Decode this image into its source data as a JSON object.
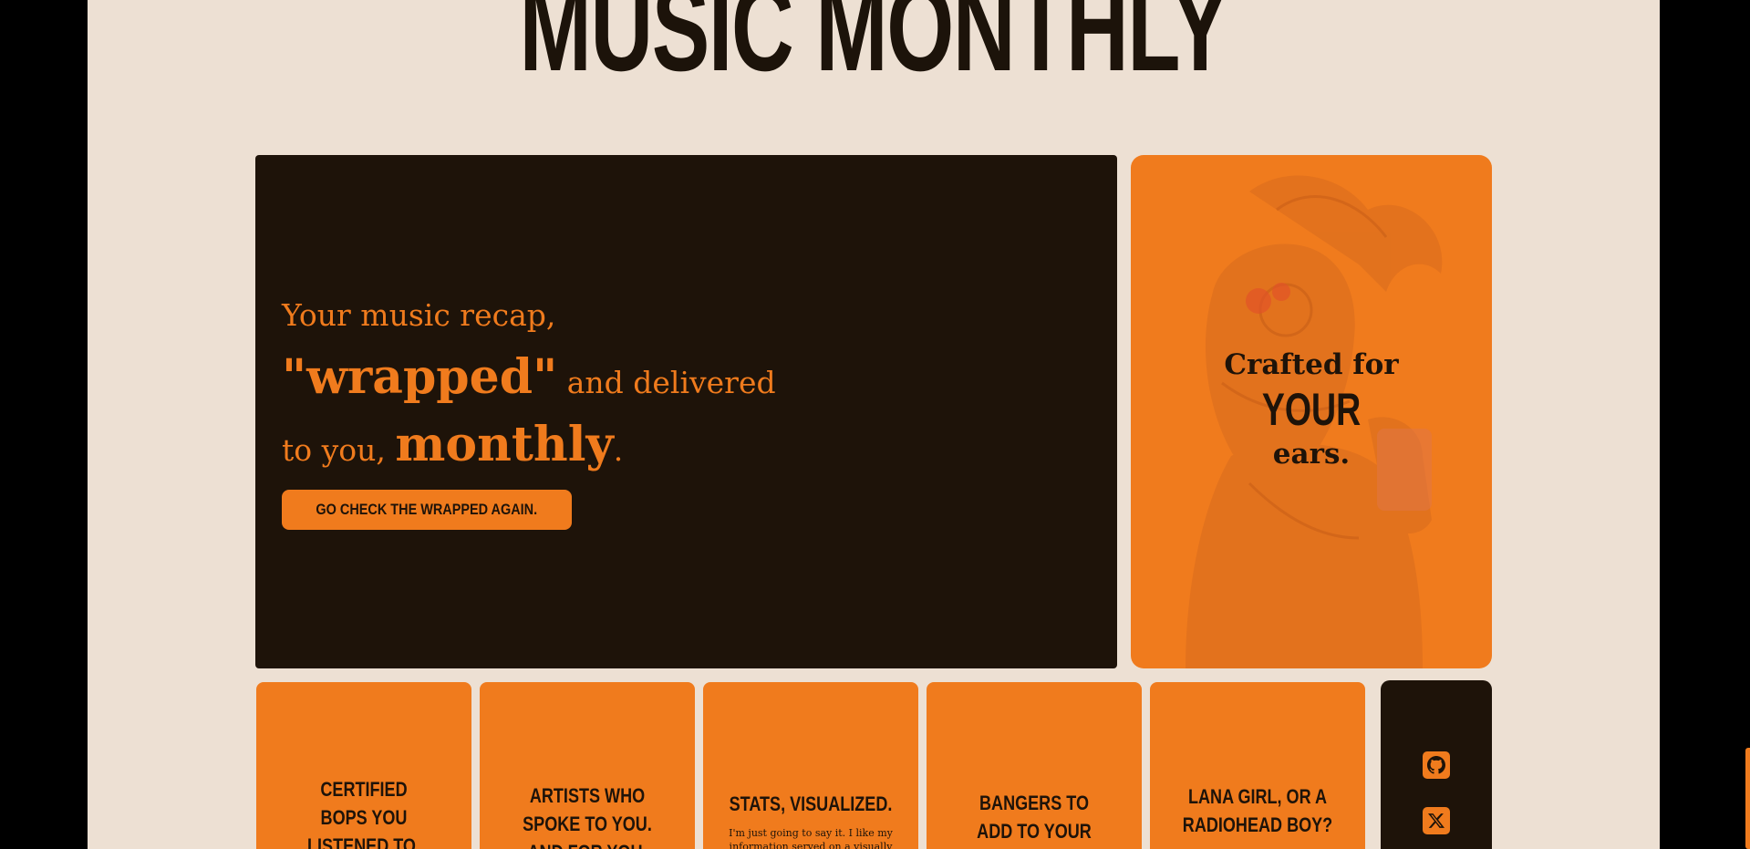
{
  "site": {
    "title": "MUSIC MONTHLY"
  },
  "hero": {
    "line1": "Your music recap,",
    "wrapped": "\"wrapped\"",
    "and_delivered": "and delivered",
    "to_you": "to you,",
    "monthly": "monthly",
    "period": ".",
    "cta_label": "GO CHECK THE WRAPPED AGAIN."
  },
  "side_card": {
    "line1": "Crafted for",
    "line2": "YOUR",
    "line3": "ears."
  },
  "cards": [
    {
      "title_lines": [
        "CERTIFIED",
        "BOPS YOU",
        "LISTENED TO."
      ]
    },
    {
      "title_lines": [
        "ARTISTS WHO",
        "SPOKE TO YOU.",
        "AND FOR YOU."
      ]
    },
    {
      "title_lines": [
        "STATS, VISUALIZED."
      ],
      "subtitle": "I'm just going to say it. I like my information served on a visually stunning"
    },
    {
      "title_lines": [
        "BANGERS TO",
        "ADD TO YOUR PLAYLISTS."
      ]
    },
    {
      "title_lines": [
        "LANA GIRL, OR A",
        "RADIOHEAD BOY?"
      ]
    }
  ],
  "social": {
    "icons": [
      "github-icon",
      "x-twitter-icon"
    ]
  },
  "colors": {
    "accent": "#f07b1d",
    "dark": "#1e1309",
    "background": "#ede0d3"
  }
}
